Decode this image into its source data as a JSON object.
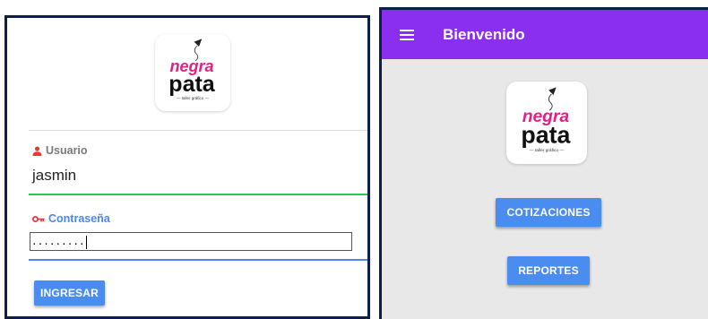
{
  "login": {
    "logo": {
      "line1": "negra",
      "line2": "pata",
      "tagline": "— taller gráfico —"
    },
    "user_label": "Usuario",
    "user_value": "jasmin",
    "password_label": "Contraseña",
    "password_value": ".........",
    "submit_label": "INGRESAR",
    "user_icon": "user-icon",
    "password_icon": "key-icon"
  },
  "app": {
    "title": "Bienvenido",
    "menu_icon": "hamburger-menu-icon",
    "logo": {
      "line1": "negra",
      "line2": "pata",
      "tagline": "— taller gráfico —"
    },
    "buttons": [
      {
        "label": "COTIZACIONES"
      },
      {
        "label": "REPORTES"
      }
    ]
  },
  "colors": {
    "appbar": "#8a2ff0",
    "button": "#4b8cf0",
    "green_line": "#2dc653",
    "blue_line": "#4b87f0",
    "brand_magenta": "#e0218a",
    "icon_red": "#e53935",
    "frame": "#0b1f47"
  }
}
